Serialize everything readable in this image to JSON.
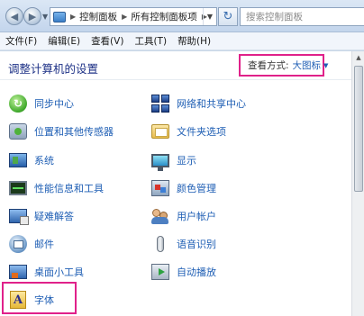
{
  "address_bar": {
    "crumbs": [
      "控制面板",
      "所有控制面板项"
    ],
    "search_placeholder": "搜索控制面板"
  },
  "menu": [
    "文件(F)",
    "编辑(E)",
    "查看(V)",
    "工具(T)",
    "帮助(H)"
  ],
  "header": {
    "title": "调整计算机的设置",
    "view_label": "查看方式:",
    "view_value": "大图标"
  },
  "items_left": [
    {
      "label": "同步中心",
      "icon": "sync-center-icon"
    },
    {
      "label": "位置和其他传感器",
      "icon": "location-sensors-icon"
    },
    {
      "label": "系统",
      "icon": "system-icon"
    },
    {
      "label": "性能信息和工具",
      "icon": "performance-icon"
    },
    {
      "label": "疑难解答",
      "icon": "troubleshooting-icon"
    },
    {
      "label": "邮件",
      "icon": "mail-icon"
    },
    {
      "label": "桌面小工具",
      "icon": "desktop-gadgets-icon"
    },
    {
      "label": "字体",
      "icon": "fonts-icon"
    }
  ],
  "items_right": [
    {
      "label": "网络和共享中心",
      "icon": "network-sharing-icon"
    },
    {
      "label": "文件夹选项",
      "icon": "folder-options-icon"
    },
    {
      "label": "显示",
      "icon": "display-icon"
    },
    {
      "label": "颜色管理",
      "icon": "color-management-icon"
    },
    {
      "label": "用户帐户",
      "icon": "user-accounts-icon"
    },
    {
      "label": "语音识别",
      "icon": "speech-recognition-icon"
    },
    {
      "label": "自动播放",
      "icon": "autoplay-icon"
    }
  ],
  "colors": {
    "link": "#1e5eb4",
    "title": "#1e3287",
    "highlight": "#e0218a"
  }
}
